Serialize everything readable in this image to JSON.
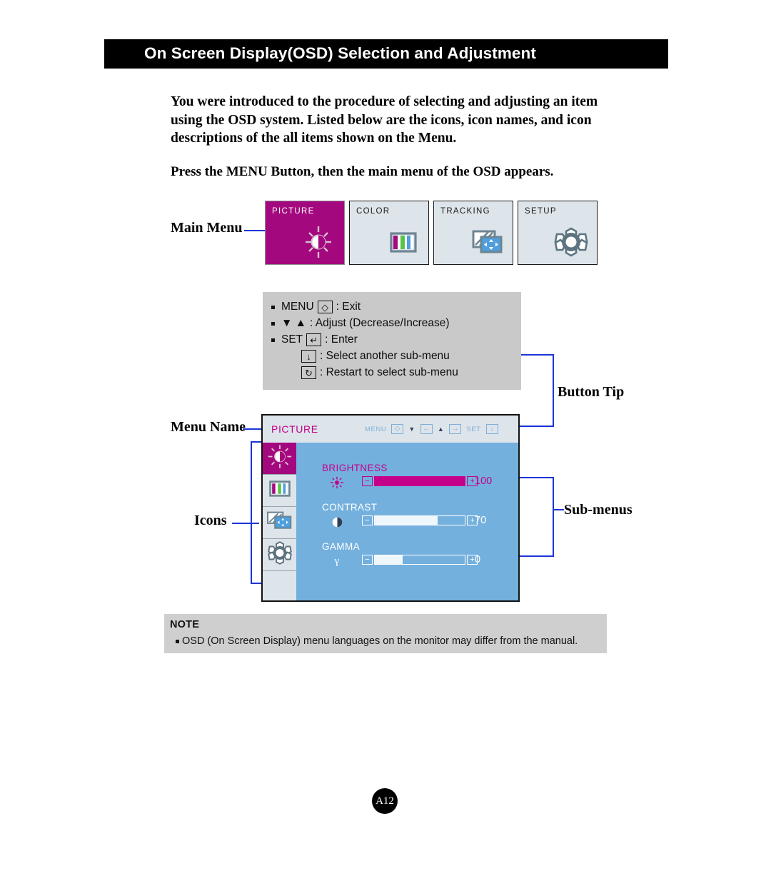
{
  "header": {
    "title": "On Screen Display(OSD) Selection and Adjustment"
  },
  "intro": {
    "paragraph1": "You were introduced to the procedure of selecting and adjusting an item using the OSD system.  Listed below are the icons, icon names, and icon descriptions of the all items shown on the Menu.",
    "paragraph2": "Press the MENU Button, then the main menu of the OSD appears."
  },
  "callouts": {
    "main_menu": "Main Menu",
    "menu_name": "Menu Name",
    "icons": "Icons",
    "button_tip": "Button Tip",
    "sub_menus": "Sub-menus"
  },
  "main_menu": {
    "tabs": [
      {
        "label": "PICTURE",
        "icon": "brightness-icon",
        "selected": true
      },
      {
        "label": "COLOR",
        "icon": "color-bars-icon",
        "selected": false
      },
      {
        "label": "TRACKING",
        "icon": "tracking-icon",
        "selected": false
      },
      {
        "label": "SETUP",
        "icon": "gear-icon",
        "selected": false
      }
    ]
  },
  "button_tip": {
    "lines": [
      {
        "bullet": true,
        "prefix": "MENU",
        "key": "menu-exit-icon",
        "keyglyph": "◇",
        "text": ": Exit"
      },
      {
        "bullet": true,
        "prefix": "▼ ▲",
        "key": "",
        "keyglyph": "",
        "text": ": Adjust (Decrease/Increase)"
      },
      {
        "bullet": true,
        "prefix": "SET",
        "key": "enter-icon",
        "keyglyph": "↵",
        "text": ": Enter"
      },
      {
        "bullet": false,
        "prefix": "",
        "key": "down-arrow-icon",
        "keyglyph": "↓",
        "text": ": Select another sub-menu"
      },
      {
        "bullet": false,
        "prefix": "",
        "key": "restart-icon",
        "keyglyph": "↻",
        "text": ": Restart to select sub-menu"
      }
    ]
  },
  "osd": {
    "title": "PICTURE",
    "buttonbar": [
      {
        "label": "MENU",
        "key": "menu-exit-icon",
        "keyglyph": "◇"
      },
      {
        "label": "▼",
        "key": "left-arrow-icon",
        "keyglyph": "←"
      },
      {
        "label": "▲",
        "key": "right-arrow-icon",
        "keyglyph": "→"
      },
      {
        "label": "SET",
        "key": "down-arrow-icon",
        "keyglyph": "↓"
      }
    ],
    "side_icons": [
      {
        "name": "brightness-icon",
        "selected": true
      },
      {
        "name": "color-bars-icon",
        "selected": false
      },
      {
        "name": "tracking-icon",
        "selected": false
      },
      {
        "name": "gear-icon",
        "selected": false
      },
      {
        "name": "blank-slot",
        "selected": false
      }
    ],
    "submenus": [
      {
        "name": "BRIGHTNESS",
        "icon": "sun-icon",
        "value": "100",
        "percent": 100,
        "accent": "#c4008a"
      },
      {
        "name": "CONTRAST",
        "icon": "halfmoon-icon",
        "value": "70",
        "percent": 70,
        "accent": "#ffffff"
      },
      {
        "name": "GAMMA",
        "icon": "gamma-icon",
        "value": "0",
        "percent": 30,
        "accent": "#ffffff"
      }
    ]
  },
  "note": {
    "heading": "NOTE",
    "body": "OSD (On Screen Display) menu languages on the monitor may differ from the manual."
  },
  "footer": {
    "page": "A12"
  },
  "colors": {
    "accent_magenta": "#a4087e",
    "osd_blue": "#74b0dd",
    "panel_grey": "#dde4ea",
    "leader_blue": "#1c35d6",
    "note_grey": "#cfcfcf"
  }
}
